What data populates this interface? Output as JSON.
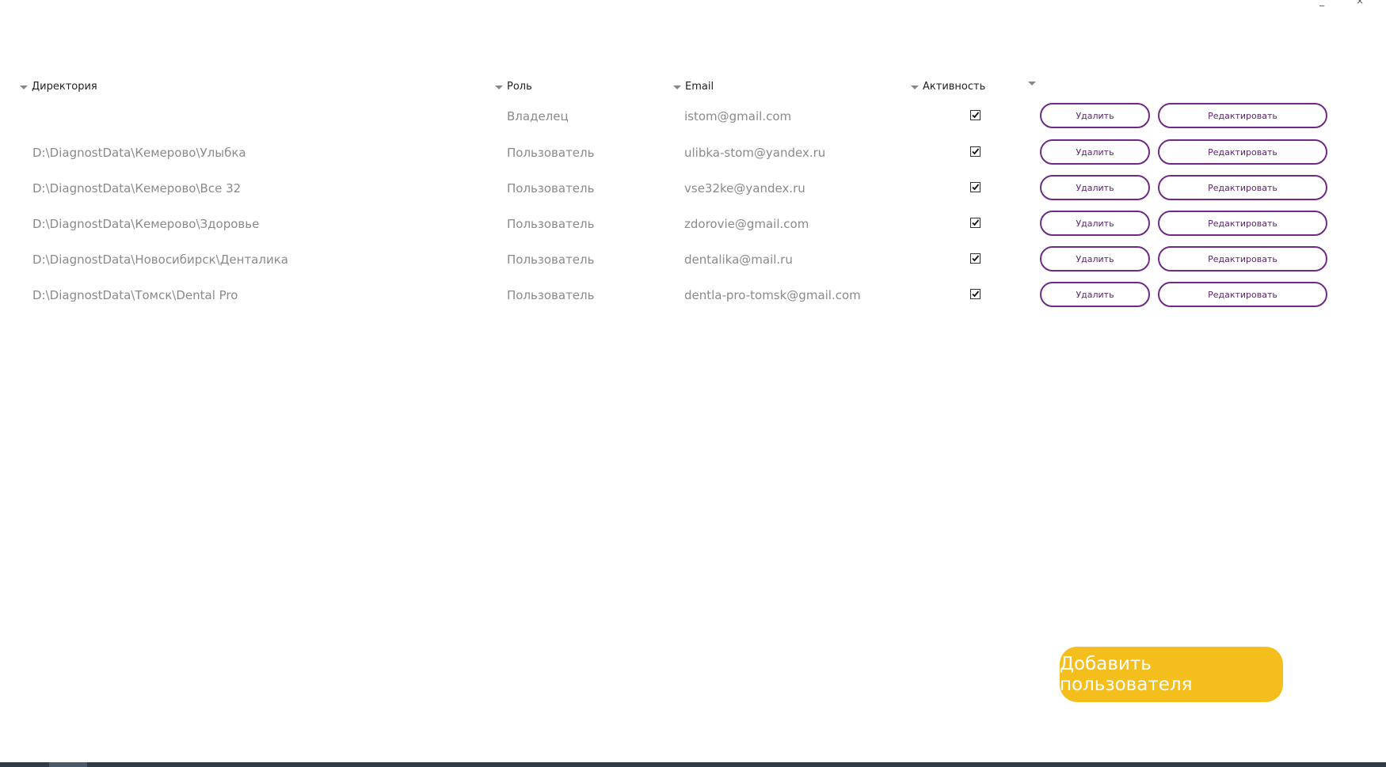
{
  "table": {
    "columns": [
      {
        "label": "Директория"
      },
      {
        "label": "Роль"
      },
      {
        "label": "Email"
      },
      {
        "label": "Активность"
      },
      {
        "label": ""
      }
    ],
    "rows": [
      {
        "directory": "",
        "role": "Владелец",
        "email": "istom@gmail.com",
        "active": true,
        "delete_label": "Удалить",
        "edit_label": "Редактировать"
      },
      {
        "directory": "D:\\DiagnostData\\Кемерово\\Улыбка",
        "role": "Пользователь",
        "email": "ulibka-stom@yandex.ru",
        "active": true,
        "delete_label": "Удалить",
        "edit_label": "Редактировать"
      },
      {
        "directory": "D:\\DiagnostData\\Кемерово\\Все 32",
        "role": "Пользователь",
        "email": "vse32ke@yandex.ru",
        "active": true,
        "delete_label": "Удалить",
        "edit_label": "Редактировать"
      },
      {
        "directory": "D:\\DiagnostData\\Кемерово\\Здоровье",
        "role": "Пользователь",
        "email": "zdorovie@gmail.com",
        "active": true,
        "delete_label": "Удалить",
        "edit_label": "Редактировать"
      },
      {
        "directory": "D:\\DiagnostData\\Новосибирск\\Денталика",
        "role": "Пользователь",
        "email": "dentalika@mail.ru",
        "active": true,
        "delete_label": "Удалить",
        "edit_label": "Редактировать"
      },
      {
        "directory": "D:\\DiagnostData\\Томск\\Dental Pro",
        "role": "Пользователь",
        "email": "dentla-pro-tomsk@gmail.com",
        "active": true,
        "delete_label": "Удалить",
        "edit_label": "Редактировать"
      }
    ]
  },
  "add_user_label": "Добавить пользователя",
  "colors": {
    "accent_purple": "#6f2a86",
    "add_button": "#f4be1d"
  }
}
